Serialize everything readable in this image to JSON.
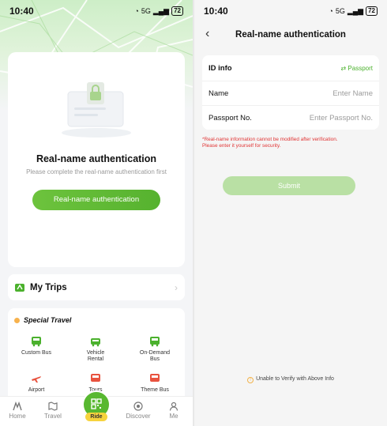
{
  "status_bar": {
    "time": "10:40",
    "battery": "72",
    "network": "5G"
  },
  "left": {
    "auth_card": {
      "title": "Real-name authentication",
      "subtitle": "Please complete the real-name authentication first",
      "button": "Real-name authentication"
    },
    "trips": {
      "label": "My Trips"
    },
    "special": {
      "heading": "Special Travel",
      "services": [
        "Custom Bus",
        "Vehicle\nRental",
        "On-Demand\nBus",
        "Airport",
        "Tours",
        "Theme Bus"
      ]
    },
    "tabbar": {
      "home": "Home",
      "travel": "Travel",
      "ride": "Ride",
      "discover": "Discover",
      "me": "Me"
    }
  },
  "right": {
    "title": "Real-name authentication",
    "id_info": {
      "label": "ID info",
      "switch": "⇄ Passport"
    },
    "name": {
      "label": "Name",
      "placeholder": "Enter Name"
    },
    "passport": {
      "label": "Passport No.",
      "placeholder": "Enter Passport No."
    },
    "warning": "*Real-name information cannot be modified after verification.\nPlease enter it yourself for security.",
    "submit": "Submit",
    "unable": "Unable to Verify with Above Info"
  },
  "colors": {
    "accent": "#58b830",
    "warning": "#e03434",
    "badge": "#f6d33e"
  }
}
